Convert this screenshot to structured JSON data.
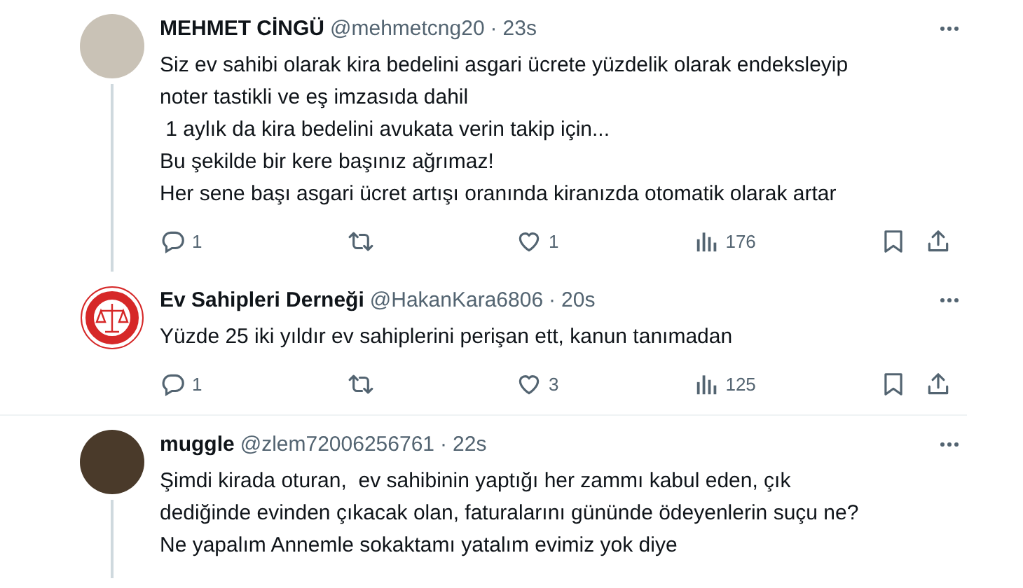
{
  "tweets": [
    {
      "avatar": {
        "kind": "photo",
        "color": "#c9c2b6"
      },
      "name": "MEHMET CİNGÜ",
      "handle": "@mehmetcng20",
      "separator": "·",
      "time": "23s",
      "thread_line": true,
      "lines": [
        "Siz ev sahibi olarak kira bedelini asgari ücrete yüzdelik olarak endeksleyip",
        "noter tastikli ve eş imzasıda dahil",
        " 1 aylık da kira bedelini avukata verin takip için...",
        "Bu şekilde bir kere başınız ağrımaz!",
        "Her sene başı asgari ücret artışı oranında kiranızda otomatik olarak artar"
      ],
      "actions": {
        "replies": "1",
        "likes": "1",
        "views": "176"
      }
    },
    {
      "avatar": {
        "kind": "emblem",
        "color": "#d62828"
      },
      "name": "Ev Sahipleri Derneği",
      "handle": "@HakanKara6806",
      "separator": "·",
      "time": "20s",
      "thread_line": false,
      "lines": [
        "Yüzde 25 iki yıldır ev sahiplerini perişan ett, kanun tanımadan"
      ],
      "actions": {
        "replies": "1",
        "likes": "3",
        "views": "125"
      }
    },
    {
      "avatar": {
        "kind": "photo",
        "color": "#4a3a2a"
      },
      "name": "muggle",
      "handle": "@zlem72006256761",
      "separator": "·",
      "time": "22s",
      "thread_line": true,
      "lines": [
        "Şimdi kirada oturan,  ev sahibinin yaptığı her zammı kabul eden, çık",
        "dediğinde evinden çıkacak olan, faturalarını gününde ödeyenlerin suçu ne?",
        "Ne yapalım Annemle sokaktamı yatalım evimiz yok diye"
      ]
    }
  ]
}
